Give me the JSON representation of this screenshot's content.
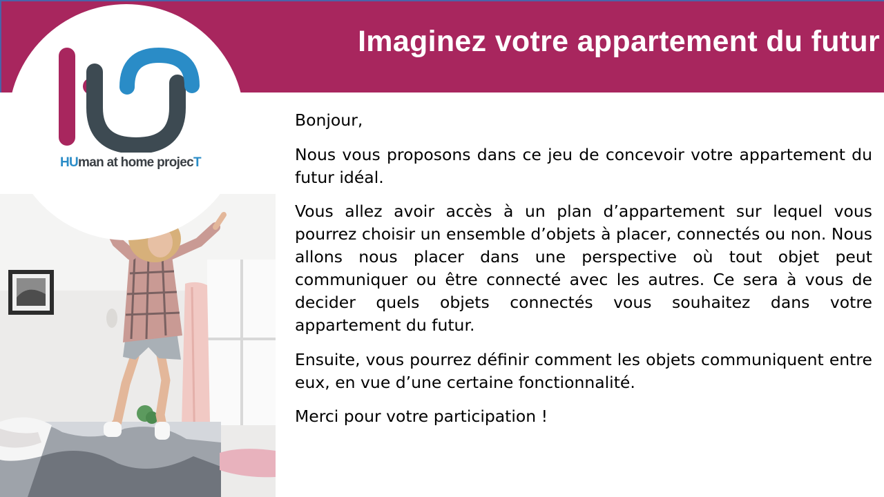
{
  "header": {
    "title": "Imaginez votre appartement du futur",
    "background_color": "#a8265e"
  },
  "logo": {
    "prefix": "HU",
    "middle": "man at home projec",
    "suffix": "T",
    "icon": "hu-logo-mark",
    "colors": {
      "magenta": "#a8265e",
      "blue": "#2a8cc7",
      "gray": "#3d4a52"
    }
  },
  "photo": {
    "icon": "woman-jumping-on-bed-photo"
  },
  "content": {
    "paragraphs": [
      "Bonjour,",
      "Nous vous proposons dans ce jeu de concevoir votre appartement du futur idéal.",
      "Vous allez avoir accès à un plan d’appartement sur lequel vous pourrez choisir un ensemble d’objets à placer, connectés ou non. Nous allons nous placer dans une perspective où tout objet peut communiquer ou être connecté avec les autres. Ce sera à vous de decider quels objets connectés vous souhaitez dans votre appartement du futur.",
      "Ensuite, vous pourrez définir comment les objets communiquent entre eux, en vue d’une certaine fonctionnalité.",
      "Merci pour votre participation !"
    ]
  }
}
